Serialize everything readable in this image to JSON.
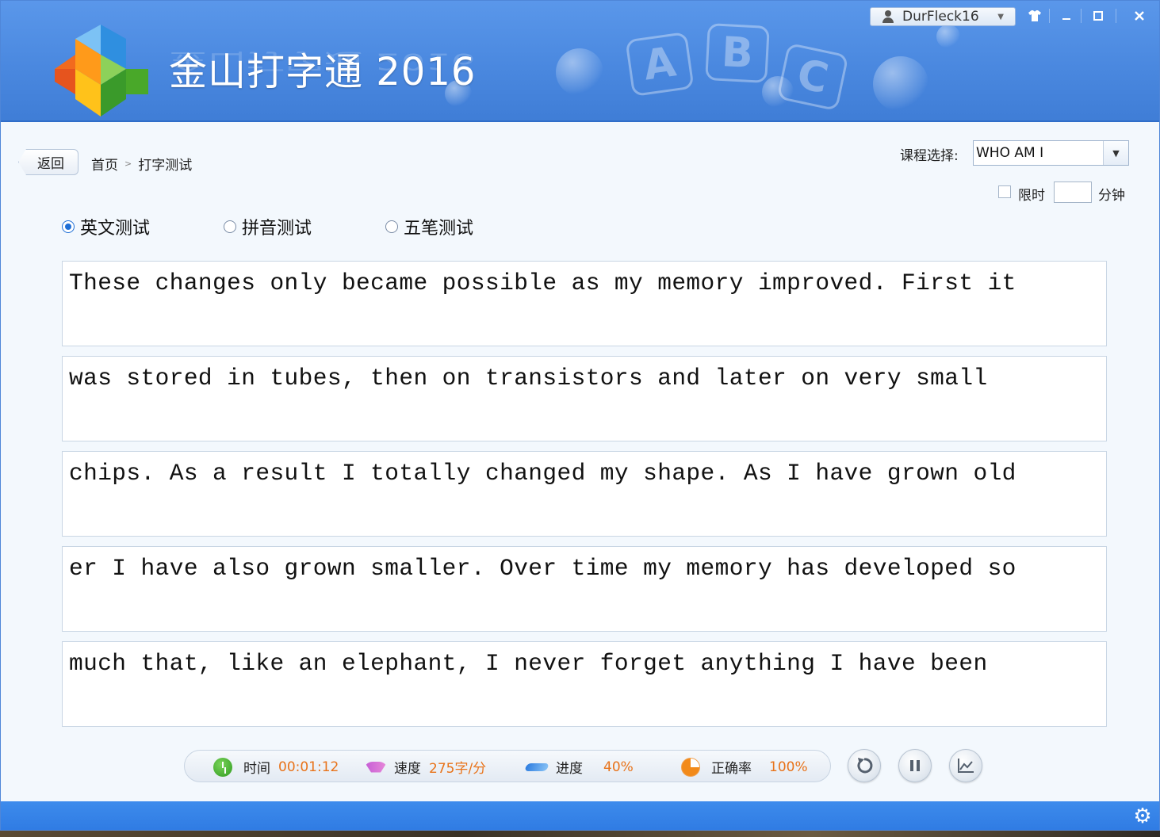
{
  "app": {
    "title": "金山打字通 2016",
    "user": "DurFleck16"
  },
  "window_controls": {
    "skin_icon": "shirt-icon",
    "minimize_icon": "minimize-icon",
    "maximize_icon": "maximize-icon",
    "close_icon": "close-icon"
  },
  "nav": {
    "back_label": "返回",
    "breadcrumb": [
      "首页",
      "打字测试"
    ],
    "breadcrumb_sep": ">"
  },
  "course": {
    "label": "课程选择:",
    "selected": "WHO AM I"
  },
  "time_limit": {
    "label": "限时",
    "value": "",
    "unit": "分钟",
    "checked": false
  },
  "modes": [
    {
      "label": "英文测试",
      "selected": true
    },
    {
      "label": "拼音测试",
      "selected": false
    },
    {
      "label": "五笔测试",
      "selected": false
    }
  ],
  "lines": [
    "These changes only became possible as my memory improved. First it",
    "was stored in tubes, then on transistors and later on very small",
    "chips. As a result I totally changed my shape. As I have grown old",
    "er I have also grown smaller. Over time my memory has developed so",
    "much that, like an elephant, I never forget anything I have been"
  ],
  "stats": {
    "time_label": "时间",
    "time_value": "00:01:12",
    "speed_label": "速度",
    "speed_value": "275字/分",
    "progress_label": "进度",
    "progress_value": "40%",
    "accuracy_label": "正确率",
    "accuracy_value": "100%"
  },
  "actions": {
    "restart_icon": "restart-icon",
    "pause_icon": "pause-icon",
    "chart_icon": "chart-icon"
  },
  "footer": {
    "settings_icon": "gear-icon"
  },
  "colors": {
    "header_blue": "#4a88df",
    "accent_orange": "#e8731a",
    "radio_blue": "#1f6fd6"
  }
}
